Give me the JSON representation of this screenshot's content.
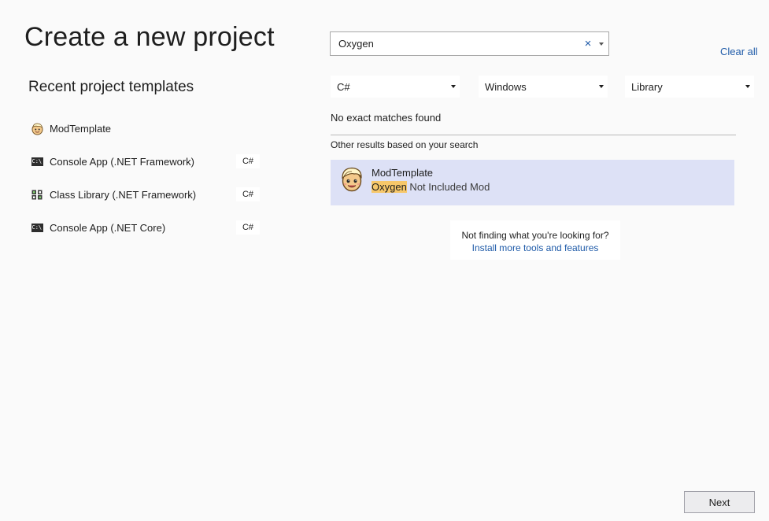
{
  "page": {
    "title": "Create a new project"
  },
  "recent": {
    "heading": "Recent project templates",
    "items": [
      {
        "label": "ModTemplate",
        "icon": "mod-face-icon",
        "lang": ""
      },
      {
        "label": "Console App (.NET Framework)",
        "icon": "console-icon",
        "lang": "C#"
      },
      {
        "label": "Class Library (.NET Framework)",
        "icon": "class-library-icon",
        "lang": "C#"
      },
      {
        "label": "Console App (.NET Core)",
        "icon": "console-icon",
        "lang": "C#"
      }
    ]
  },
  "search": {
    "value": "Oxygen",
    "clear_icon": "×",
    "clear_all": "Clear all"
  },
  "filters": {
    "language": "C#",
    "platform": "Windows",
    "project_type": "Library"
  },
  "results": {
    "no_matches": "No exact matches found",
    "other_results": "Other results based on your search",
    "items": [
      {
        "title": "ModTemplate",
        "desc_highlight": "Oxygen",
        "desc_rest": " Not Included Mod",
        "icon": "mod-face-icon"
      }
    ]
  },
  "help": {
    "question": "Not finding what you're looking for?",
    "link": "Install more tools and features"
  },
  "footer": {
    "next_label": "Next"
  },
  "colors": {
    "accent_link": "#1e5aa8",
    "selected_bg": "#dde1f6",
    "highlight": "#f6c76a"
  }
}
